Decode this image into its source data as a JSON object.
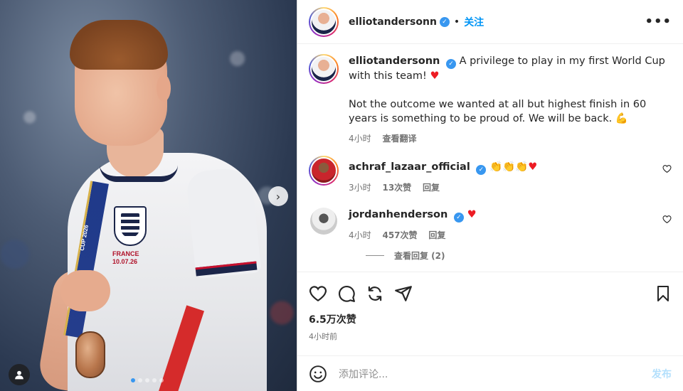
{
  "header": {
    "username": "elliotandersonn",
    "follow_label": "关注",
    "more_label": "•••"
  },
  "caption": {
    "username": "elliotandersonn",
    "line1": "A privilege to play in my first World Cup with this team!",
    "line2": "Not the outcome we wanted at all but highest finish in 60 years is something to be proud of. We will be back.",
    "time": "4小时",
    "translate": "查看翻译"
  },
  "comments": [
    {
      "username": "achraf_lazaar_official",
      "time": "3小时",
      "likes": "13次赞",
      "reply": "回复"
    },
    {
      "username": "jordanhenderson",
      "time": "4小时",
      "likes": "457次赞",
      "reply": "回复"
    }
  ],
  "view_replies": "查看回复 (2)",
  "photo_text": {
    "badge_line1": "FRANCE",
    "badge_line2": "10.07.26",
    "ribbon_text": "CUP 2026"
  },
  "likes_count": "6.5万次赞",
  "post_time": "4小时前",
  "add_comment_placeholder": "添加评论...",
  "post_button": "发布",
  "colors": {
    "accent": "#0095f6",
    "verified": "#3897f0",
    "heart": "#ed1c24"
  }
}
